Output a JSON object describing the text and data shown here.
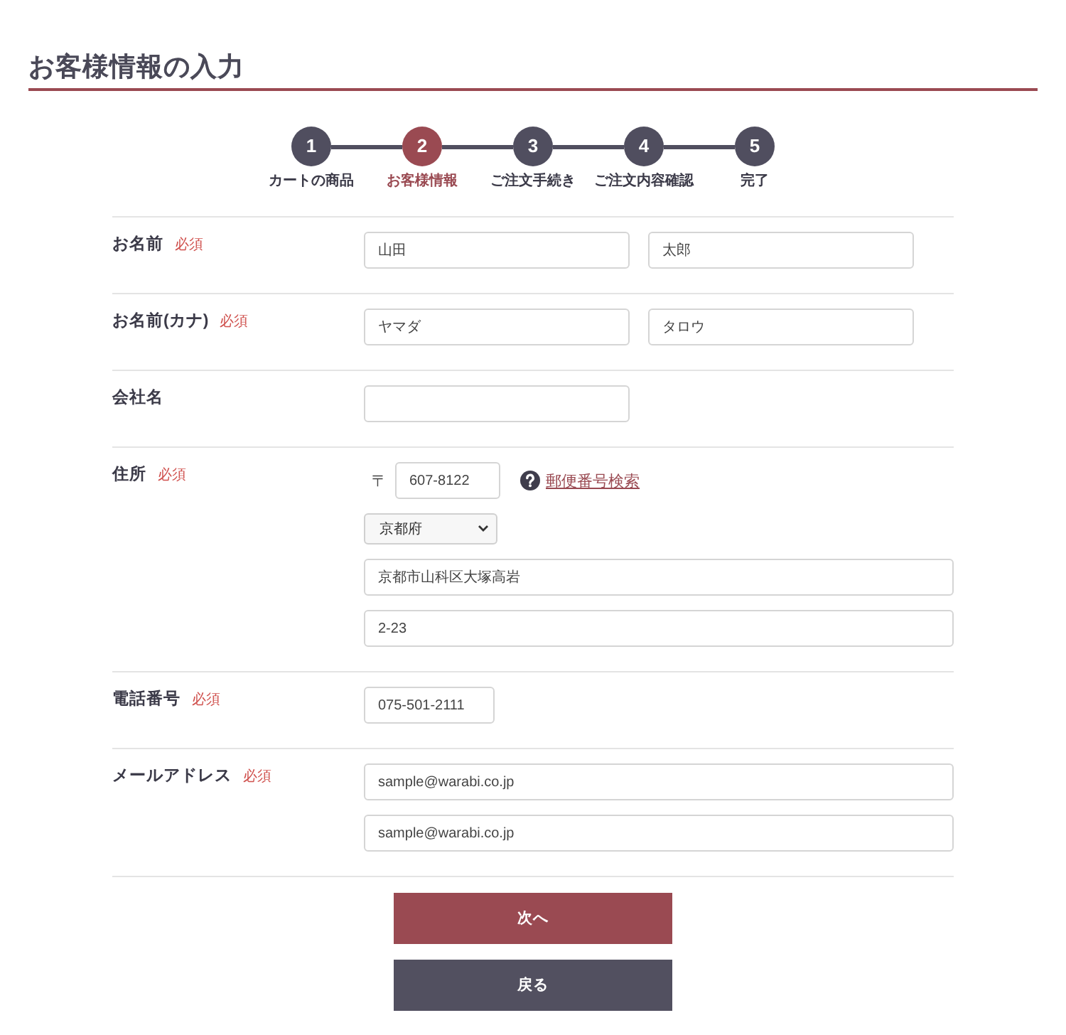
{
  "page_title": "お客様情報の入力",
  "steps": [
    {
      "number": "1",
      "label": "カートの商品",
      "selected": false
    },
    {
      "number": "2",
      "label": "お客様情報",
      "selected": true
    },
    {
      "number": "3",
      "label": "ご注文手続き",
      "selected": false
    },
    {
      "number": "4",
      "label": "ご注文内容確認",
      "selected": false
    },
    {
      "number": "5",
      "label": "完了",
      "selected": false
    }
  ],
  "form": {
    "rows": [
      {
        "label": "お名前",
        "badge": "必須",
        "fields": [
          {
            "kind": "half",
            "value": "山田"
          },
          {
            "kind": "half",
            "value": "太郎"
          }
        ]
      },
      {
        "label": "お名前(カナ)",
        "badge": "必須",
        "fields": [
          {
            "kind": "half",
            "value": "ヤマダ"
          },
          {
            "kind": "half",
            "value": "タロウ"
          }
        ]
      },
      {
        "label": "会社名",
        "fields": [
          {
            "kind": "half"
          }
        ]
      },
      {
        "label": "住所",
        "badge": "必須",
        "fields": [
          {
            "kind": "postal",
            "prefix": "〒",
            "value": "607-8122",
            "link": "郵便番号検索"
          },
          {
            "kind": "select",
            "value": "京都府"
          },
          {
            "kind": "full",
            "value": "京都市山科区大塚高岩"
          },
          {
            "kind": "full",
            "value": "2-23"
          }
        ]
      },
      {
        "label": "電話番号",
        "badge": "必須",
        "fields": [
          {
            "kind": "short",
            "value": "075-501-2111"
          }
        ]
      },
      {
        "label": "メールアドレス",
        "badge": "必須",
        "fields": [
          {
            "kind": "full",
            "value": "sample@warabi.co.jp"
          },
          {
            "kind": "full",
            "value": "sample@warabi.co.jp"
          }
        ]
      }
    ]
  },
  "buttons": [
    {
      "kind": "primary",
      "label": "次へ"
    },
    {
      "kind": "secondary",
      "label": "戻る"
    }
  ]
}
